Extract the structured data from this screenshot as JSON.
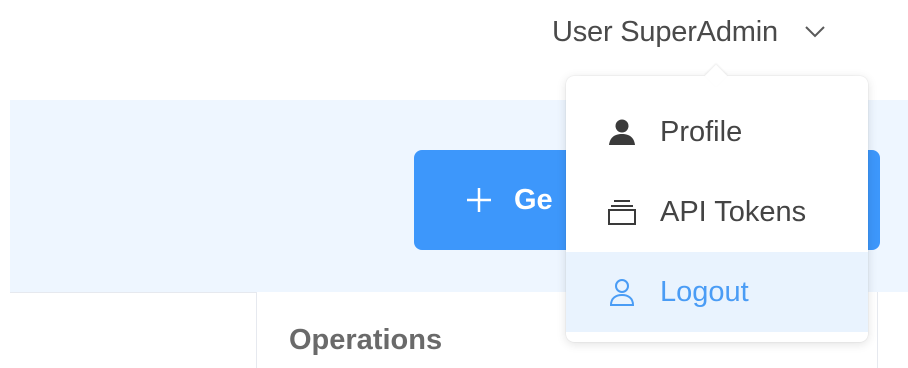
{
  "header": {
    "user_name": "User SuperAdmin",
    "user_menu_icon": "chevron-down-icon"
  },
  "toolbar": {
    "generate_label": "Ge",
    "generate_icon": "plus-icon"
  },
  "content": {
    "section_title": "Operations"
  },
  "dropdown": {
    "items": [
      {
        "label": "Profile",
        "icon": "user-filled-icon"
      },
      {
        "label": "API Tokens",
        "icon": "cards-stack-icon"
      },
      {
        "label": "Logout",
        "icon": "user-outline-icon",
        "highlighted": true
      }
    ]
  },
  "colors": {
    "primary": "#3d97fb",
    "band_bg": "#eef6ff",
    "menu_highlight_bg": "#e9f3fe",
    "menu_highlight_text": "#4a9cf5",
    "text": "#444444"
  }
}
